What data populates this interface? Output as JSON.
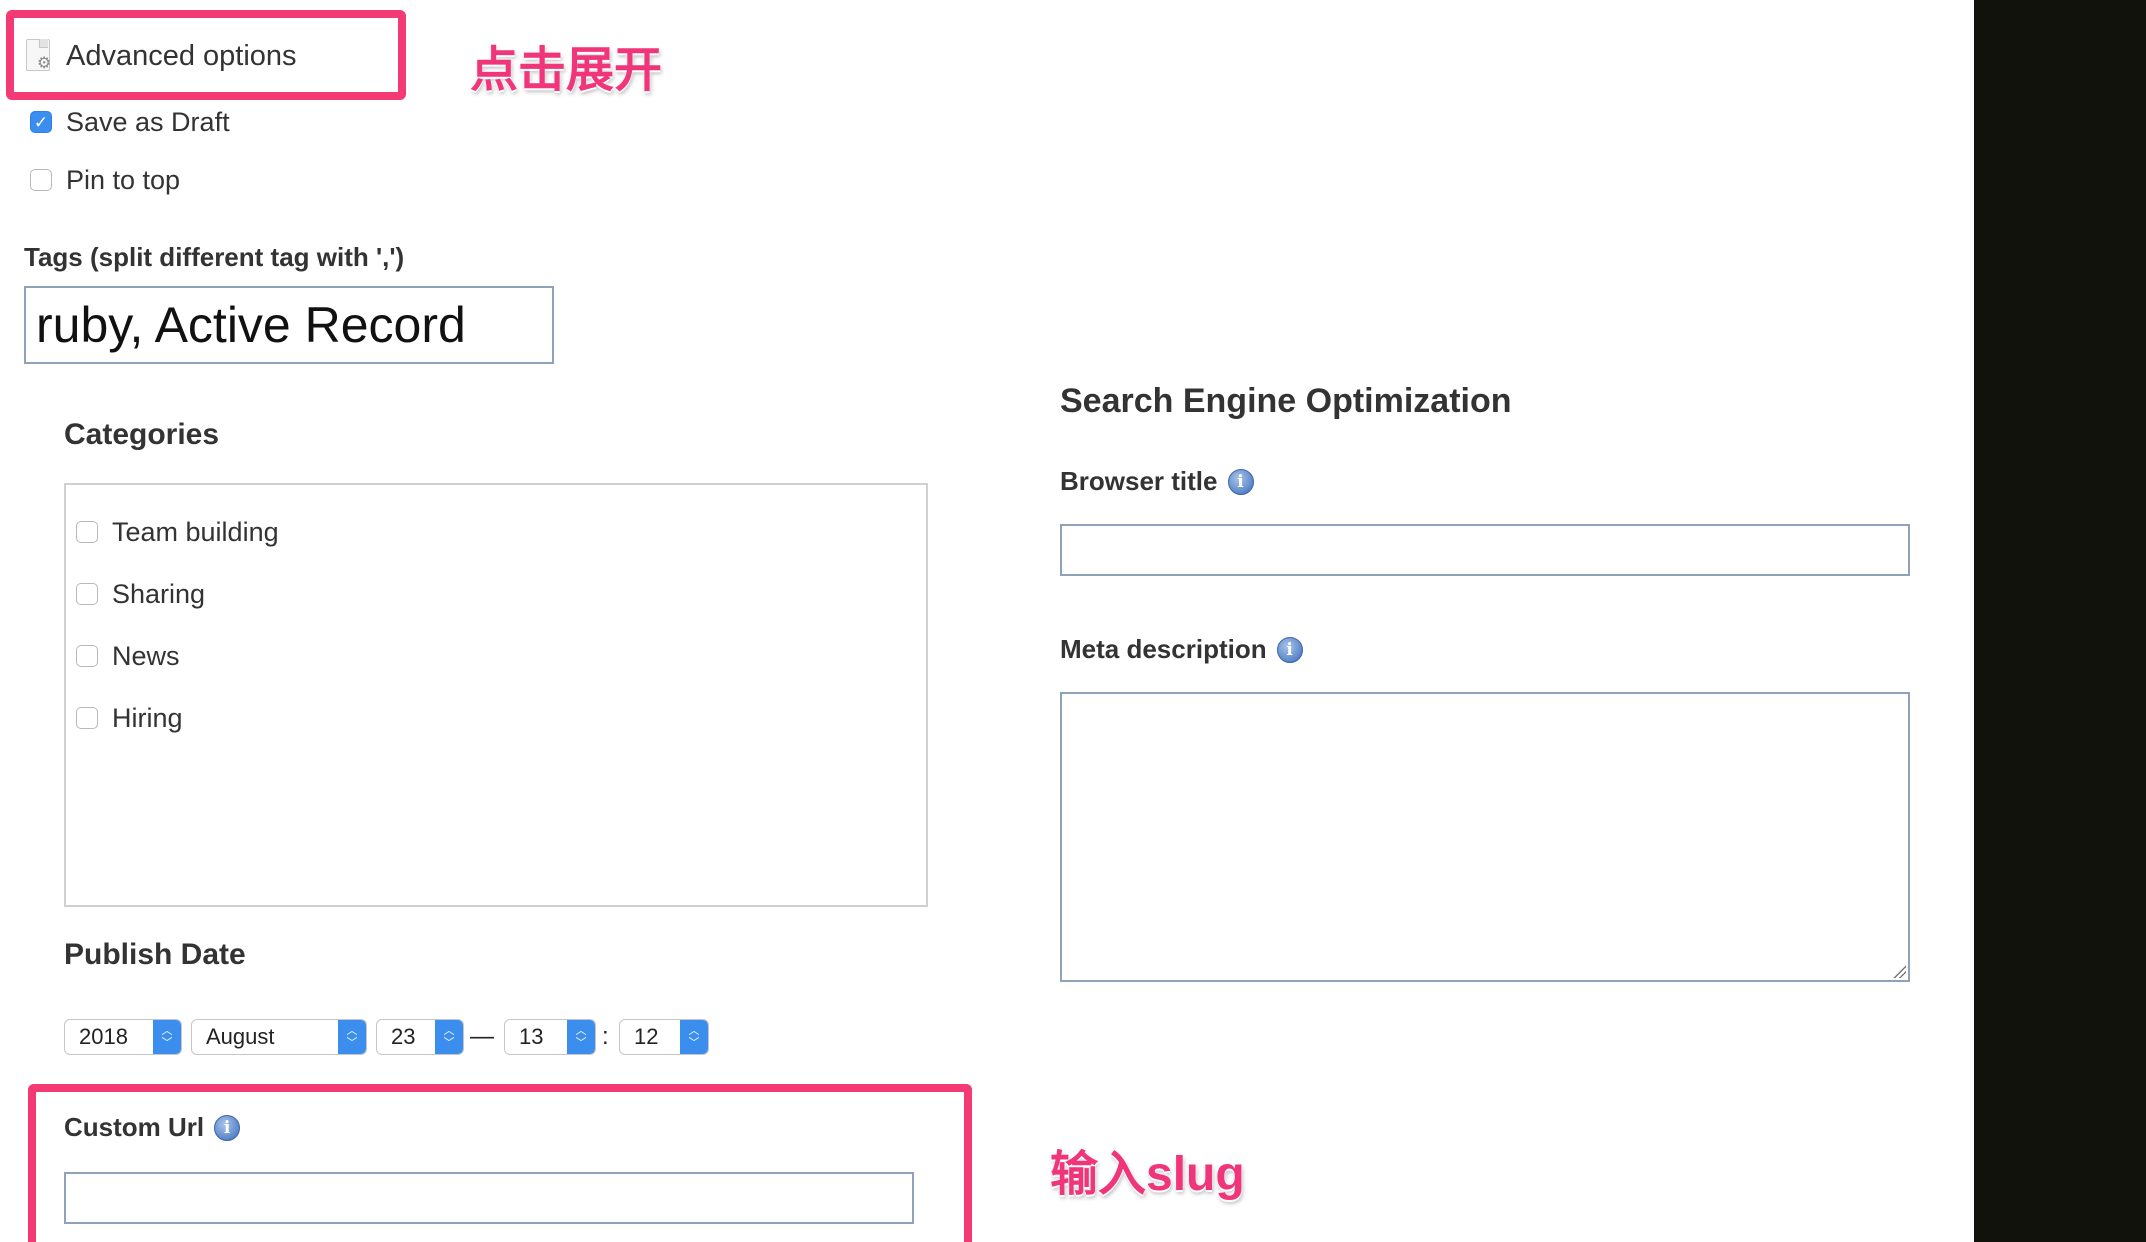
{
  "advanced_options": {
    "label": "Advanced options",
    "annotation": "点击展开"
  },
  "options": {
    "save_as_draft": {
      "label": "Save as Draft",
      "checked": true
    },
    "pin_to_top": {
      "label": "Pin to top",
      "checked": false
    }
  },
  "tags": {
    "label": "Tags (split different tag with ',')",
    "value": "ruby, Active Record"
  },
  "categories": {
    "title": "Categories",
    "items": [
      {
        "label": "Team building",
        "checked": false
      },
      {
        "label": "Sharing",
        "checked": false
      },
      {
        "label": "News",
        "checked": false
      },
      {
        "label": "Hiring",
        "checked": false
      }
    ]
  },
  "publish_date": {
    "title": "Publish Date",
    "year": "2018",
    "month": "August",
    "day": "23",
    "dash": "—",
    "hour": "13",
    "colon": ":",
    "minute": "12"
  },
  "custom_url": {
    "label": "Custom Url",
    "value": "",
    "annotation": "输入slug"
  },
  "seo": {
    "title": "Search Engine Optimization",
    "browser_title_label": "Browser title",
    "browser_title_value": "",
    "meta_description_label": "Meta description",
    "meta_description_value": ""
  },
  "icons": {
    "document": "document-gear-icon",
    "info": "info-icon",
    "check": "checkmark-icon",
    "select_arrows": "up-down-chevron-icon"
  },
  "colors": {
    "highlight": "#f33a74",
    "annotation_text": "#f0357a",
    "checkbox_checked": "#3a8eef",
    "select_arrow_bg": "#3c8eee",
    "input_border": "#8fa2b8",
    "right_panel": "#12120c"
  }
}
